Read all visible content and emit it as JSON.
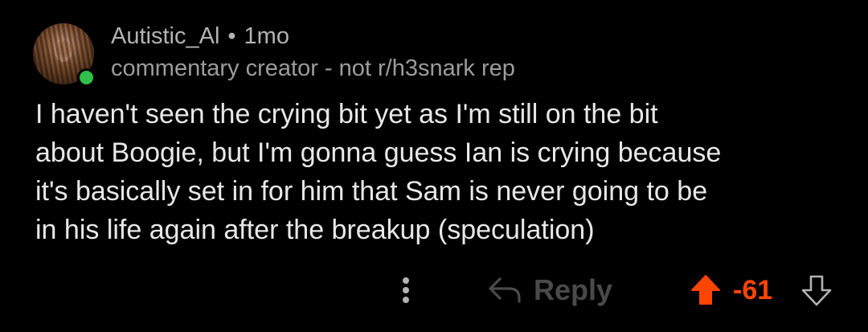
{
  "comment": {
    "author": "Autistic_Al",
    "separator": "•",
    "age": "1mo",
    "flair": "commentary creator - not r/h3snark rep",
    "online": true,
    "body_lines": [
      "I haven't seen the crying bit yet as I'm still on the bit",
      "about Boogie, but I'm gonna guess Ian is crying because",
      "it's basically set in for him that Sam is never going to be",
      "in his life again after the breakup (speculation)"
    ],
    "actions": {
      "more_icon": "vertical-dots-icon",
      "reply_icon": "reply-arrow-icon",
      "reply_label": "Reply",
      "upvote_icon": "upvote-arrow-icon",
      "score": "-61",
      "downvote_icon": "downvote-arrow-icon"
    }
  },
  "colors": {
    "background": "#000000",
    "text": "#e8e8e8",
    "meta": "#b3b3b3",
    "upvote_active": "#ff4500",
    "online": "#2fbf4a"
  }
}
